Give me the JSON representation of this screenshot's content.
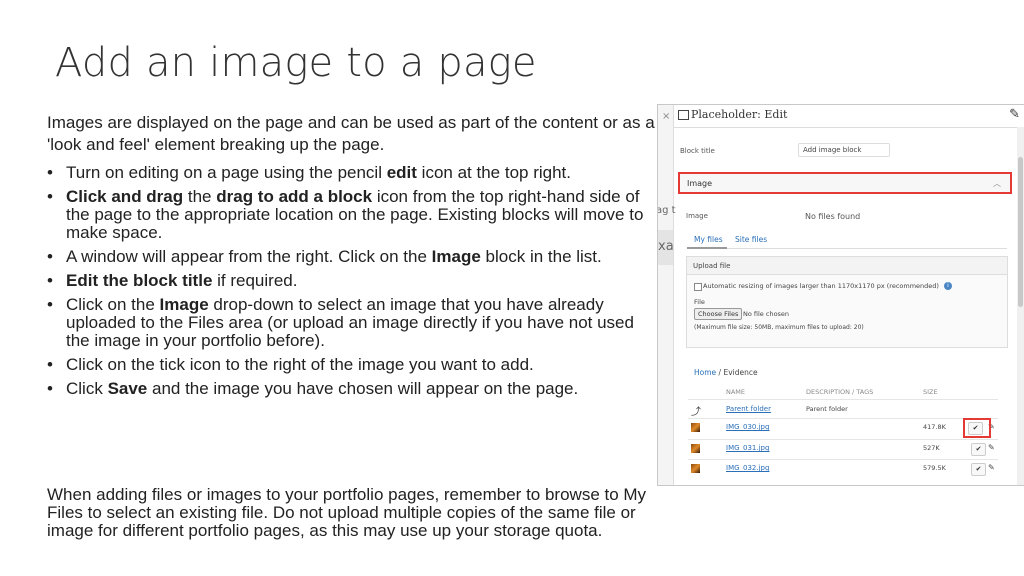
{
  "slide": {
    "title": "Add an image to a page",
    "intro": "Images are displayed on the page and can be used as part of the content or as a 'look and feel' element breaking up the page.",
    "bullets": [
      {
        "pre": "Turn on editing on a page using the pencil ",
        "b1": "edit",
        "mid": " icon at the top right.",
        "b2": "",
        "post": ""
      },
      {
        "pre": "",
        "b1": "Click and drag",
        "mid": " the ",
        "b2": "drag to add a block",
        "post": " icon from the top right-hand side of the page to the appropriate location on the page. Existing blocks will move to make space."
      },
      {
        "pre": "A window will appear from the right. Click on the ",
        "b1": "Image",
        "mid": " block in the list.",
        "b2": "",
        "post": ""
      },
      {
        "pre": "",
        "b1": "Edit the block title",
        "mid": " if required.",
        "b2": "",
        "post": ""
      },
      {
        "pre": "Click on the ",
        "b1": "Image",
        "mid": " drop-down to select an image that you have already uploaded to the Files area (or upload an image directly if you have not used the image in your portfolio before).",
        "b2": "",
        "post": ""
      },
      {
        "pre": "Click on the tick icon to the right of the image you want to add.",
        "b1": "",
        "mid": "",
        "b2": "",
        "post": ""
      },
      {
        "pre": "Click ",
        "b1": "Save",
        "mid": " and the image you have chosen will appear on the page.",
        "b2": "",
        "post": ""
      }
    ],
    "footer": "When adding files or images to your portfolio pages, remember to browse to My Files to select an existing file. Do not upload multiple copies of the same file or image for different portfolio pages, as this may use up your storage quota."
  },
  "screenshot": {
    "close": "×",
    "header_title": "Placeholder: Edit",
    "clip_left_1": "ag t",
    "clip_left_2": "xa",
    "block_title_label": "Block title",
    "block_title_value": "Add image block",
    "image_section": "Image",
    "image_label": "Image",
    "no_files": "No files found",
    "tab_my_files": "My files",
    "tab_site_files": "Site files",
    "upload_file": "Upload file",
    "auto_resize": "Automatic resizing of images larger than 1170x1170 px (recommended)",
    "file_label": "File",
    "choose_files": "Choose Files",
    "no_file_chosen": "No file chosen",
    "max_size": "(Maximum file size: 50MB, maximum files to upload: 20)",
    "breadcrumb_home": "Home",
    "breadcrumb_sep": " / ",
    "breadcrumb_current": "Evidence",
    "columns": {
      "name": "NAME",
      "desc": "DESCRIPTION / TAGS",
      "size": "SIZE"
    },
    "parent": {
      "name": "Parent folder",
      "desc": "Parent folder"
    },
    "files": [
      {
        "name": "IMG_030.jpg",
        "size": "417.8K"
      },
      {
        "name": "IMG_031.jpg",
        "size": "527K"
      },
      {
        "name": "IMG_032.jpg",
        "size": "579.5K"
      }
    ],
    "accent": "#e53935",
    "link_color": "#2a6fb8"
  }
}
